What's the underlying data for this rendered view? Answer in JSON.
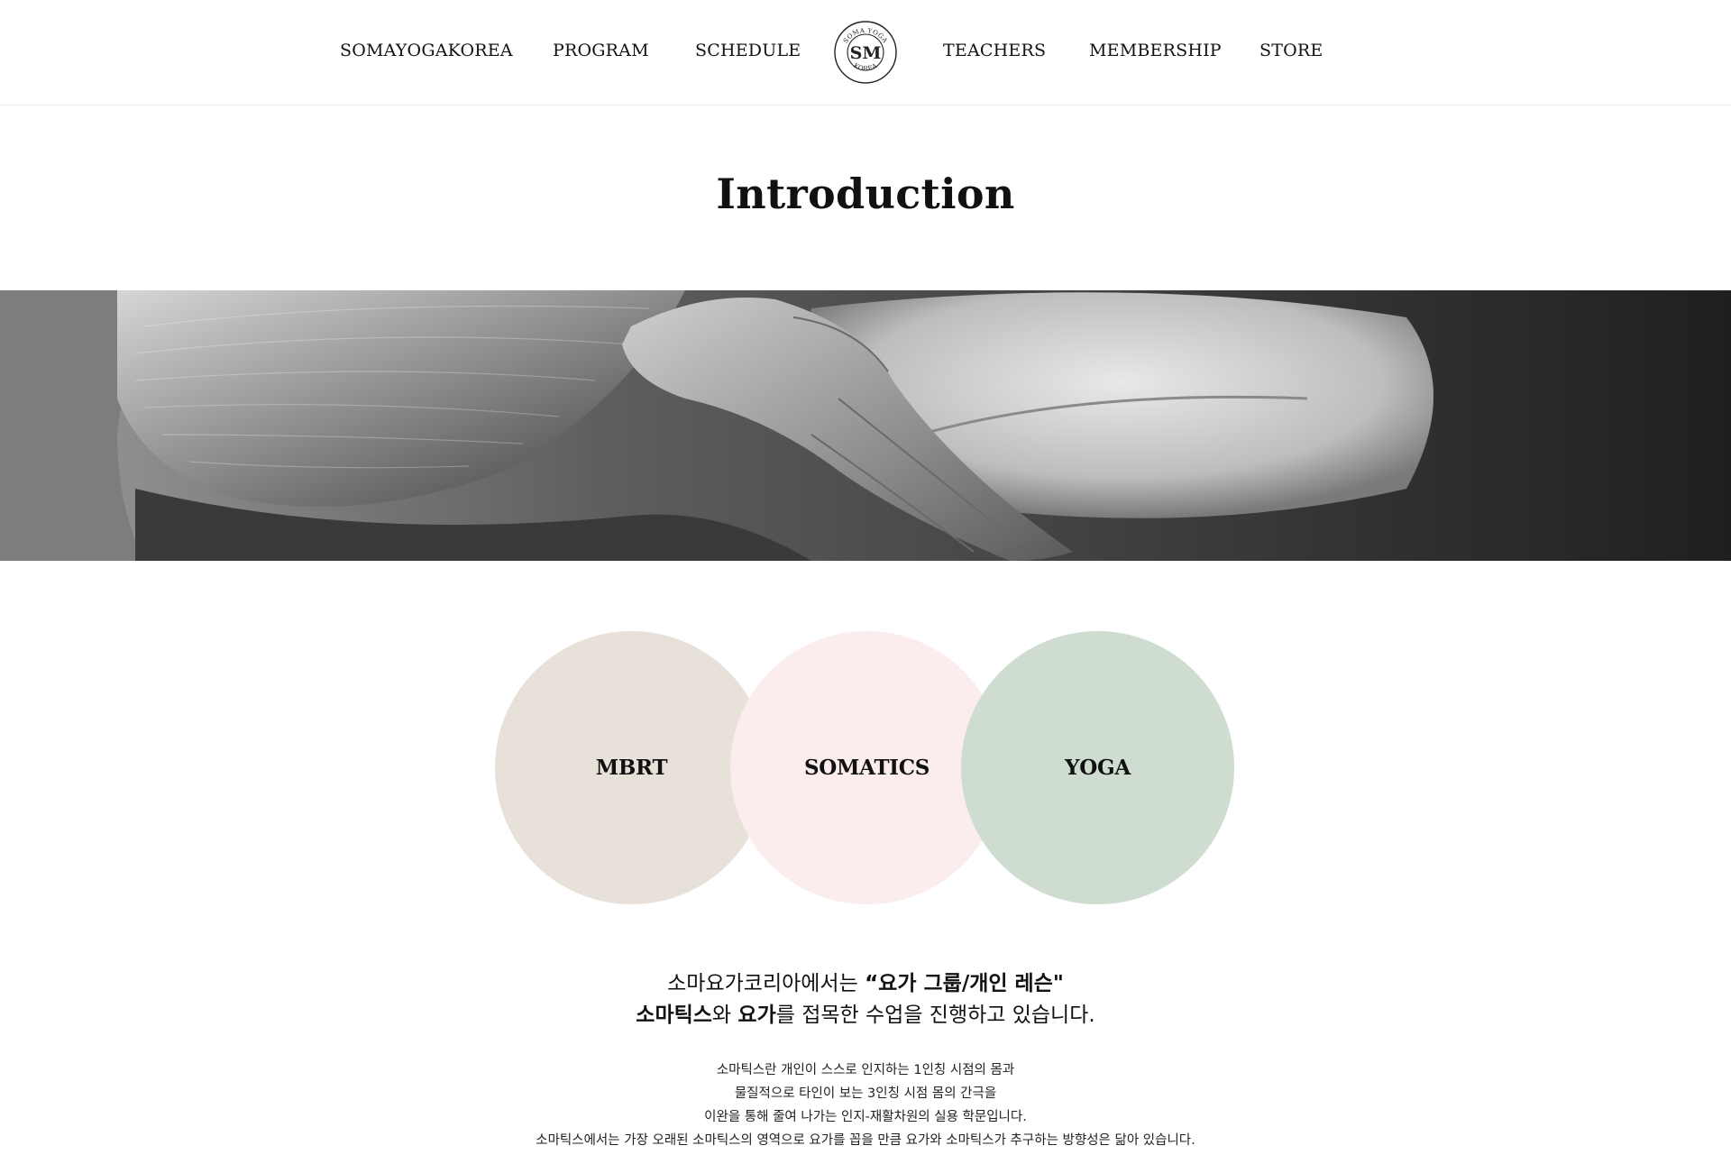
{
  "nav": {
    "items": [
      "SOMAYOGAKOREA",
      "PROGRAM",
      "SCHEDULE",
      "TEACHERS",
      "MEMBERSHIP",
      "STORE"
    ],
    "logo": {
      "top_text": "SOMA YOGA",
      "bottom_text": "KOREA",
      "monogram": "SM",
      "icon": "soma-yoga-logo"
    }
  },
  "page": {
    "title": "Introduction"
  },
  "hero": {
    "icon": "hand-on-head-photo"
  },
  "circles": [
    {
      "label": "MBRT",
      "color": "#e7e1da"
    },
    {
      "label": "SOMATICS",
      "color": "#fbeced"
    },
    {
      "label": "YOGA",
      "color": "#cfdcd0"
    }
  ],
  "intro": {
    "line1_prefix": "소마요가코리아에서는 ",
    "line1_bold": "“요가 그룹/개인 레슨\"",
    "line2_bold1": "소마틱스",
    "line2_mid": "와 ",
    "line2_bold2": "요가",
    "line2_suffix": "를 접목한 수업을 진행하고 있습니다."
  },
  "description": [
    "소마틱스란 개인이 스스로 인지하는 1인칭 시점의 몸과",
    "물질적으로 타인이 보는 3인칭 시점 몸의 간극을",
    "이완을 통해 줄여 나가는 인지-재활차원의 실용 학문입니다.",
    "소마틱스에서는 가장 오래된 소마틱스의 영역으로 요가를 꼽을 만큼 요가와 소마틱스가 추구하는 방향성은 닮아 있습니다."
  ]
}
